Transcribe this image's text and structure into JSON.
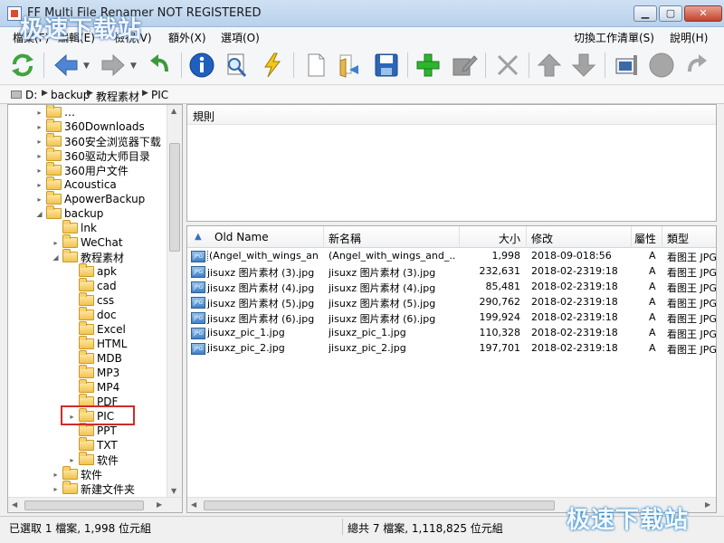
{
  "window": {
    "title": "FF Multi File Renamer NOT REGISTERED",
    "min_glyph": "▁",
    "max_glyph": "▢",
    "close_glyph": "✕"
  },
  "menu": {
    "file": "檔案(F)",
    "edit": "編輯(E)",
    "view": "檢視(V)",
    "extra": "額外(X)",
    "options": "選項(O)",
    "switch_work_list": "切換工作清單(S)",
    "help": "說明(H)"
  },
  "toolbar": {
    "icons": [
      "refresh-icon",
      "back-icon",
      "forward-icon",
      "undo-icon",
      "info-icon",
      "zoom-icon",
      "lightning-icon",
      "new-file-icon",
      "open-folder-icon",
      "save-icon",
      "add-icon",
      "edit-icon",
      "delete-icon",
      "move-up-icon",
      "move-down-icon",
      "config-icon",
      "circle-icon",
      "redo-icon"
    ]
  },
  "pathbar": {
    "drive": "D:",
    "crumbs": [
      "backup",
      "教程素材",
      "PIC"
    ]
  },
  "tree": {
    "items": [
      {
        "label": "…",
        "expander": "▸"
      },
      {
        "label": "360Downloads",
        "expander": "▸"
      },
      {
        "label": "360安全浏览器下载",
        "expander": "▸"
      },
      {
        "label": "360驱动大师目录",
        "expander": "▸"
      },
      {
        "label": "360用户文件",
        "expander": "▸"
      },
      {
        "label": "Acoustica",
        "expander": "▸"
      },
      {
        "label": "ApowerBackup",
        "expander": "▸"
      },
      {
        "label": "backup",
        "expander": "◢"
      },
      {
        "label": "lnk",
        "expander": ""
      },
      {
        "label": "WeChat",
        "expander": "▸"
      },
      {
        "label": "教程素材",
        "expander": "◢"
      },
      {
        "label": "apk",
        "expander": ""
      },
      {
        "label": "cad",
        "expander": ""
      },
      {
        "label": "css",
        "expander": ""
      },
      {
        "label": "doc",
        "expander": ""
      },
      {
        "label": "Excel",
        "expander": ""
      },
      {
        "label": "HTML",
        "expander": ""
      },
      {
        "label": "MDB",
        "expander": ""
      },
      {
        "label": "MP3",
        "expander": ""
      },
      {
        "label": "MP4",
        "expander": ""
      },
      {
        "label": "PDF",
        "expander": ""
      },
      {
        "label": "PIC",
        "expander": "▸"
      },
      {
        "label": "PPT",
        "expander": ""
      },
      {
        "label": "TXT",
        "expander": ""
      },
      {
        "label": "软件",
        "expander": "▸"
      },
      {
        "label": "软件",
        "expander": "▸"
      },
      {
        "label": "新建文件夹",
        "expander": "▸"
      }
    ]
  },
  "rules": {
    "header": "規則"
  },
  "file_list": {
    "columns": {
      "old_name": "Old Name",
      "new_name": "新名稱",
      "size": "大小",
      "modified": "修改",
      "attr": "屬性",
      "type": "類型"
    },
    "rows": [
      {
        "old": "(Angel_with_wings_an....",
        "new": "(Angel_with_wings_and_....",
        "size": "1,998",
        "date": "2018-09-01",
        "time": "8:56",
        "attr": "A",
        "type": "看图王 JPG"
      },
      {
        "old": "jisuxz 图片素材 (3).jpg",
        "new": "jisuxz 图片素材 (3).jpg",
        "size": "232,631",
        "date": "2018-02-23",
        "time": "19:18",
        "attr": "A",
        "type": "看图王 JPG"
      },
      {
        "old": "jisuxz 图片素材 (4).jpg",
        "new": "jisuxz 图片素材 (4).jpg",
        "size": "85,481",
        "date": "2018-02-23",
        "time": "19:18",
        "attr": "A",
        "type": "看图王 JPG"
      },
      {
        "old": "jisuxz 图片素材 (5).jpg",
        "new": "jisuxz 图片素材 (5).jpg",
        "size": "290,762",
        "date": "2018-02-23",
        "time": "19:18",
        "attr": "A",
        "type": "看图王 JPG"
      },
      {
        "old": "jisuxz 图片素材 (6).jpg",
        "new": "jisuxz 图片素材 (6).jpg",
        "size": "199,924",
        "date": "2018-02-23",
        "time": "19:18",
        "attr": "A",
        "type": "看图王 JPG"
      },
      {
        "old": "jisuxz_pic_1.jpg",
        "new": "jisuxz_pic_1.jpg",
        "size": "110,328",
        "date": "2018-02-23",
        "time": "19:18",
        "attr": "A",
        "type": "看图王 JPG"
      },
      {
        "old": "jisuxz_pic_2.jpg",
        "new": "jisuxz_pic_2.jpg",
        "size": "197,701",
        "date": "2018-02-23",
        "time": "19:18",
        "attr": "A",
        "type": "看图王 JPG"
      }
    ],
    "icon_text": "JPG"
  },
  "status": {
    "left": "已選取 1 檔案, 1,998 位元組",
    "right": "總共 7 檔案, 1,118,825 位元組"
  },
  "watermark": {
    "top": "极速下载站",
    "bottom": "极速下载站"
  },
  "colors": {
    "accent": "#3770c2",
    "highlight_box": "#d12b2b",
    "refresh_green": "#3da53d",
    "arrow_blue": "#4f86d4",
    "info_blue": "#1f5fbf",
    "add_green": "#2db52d",
    "gray_icon": "#9a9a9a"
  }
}
